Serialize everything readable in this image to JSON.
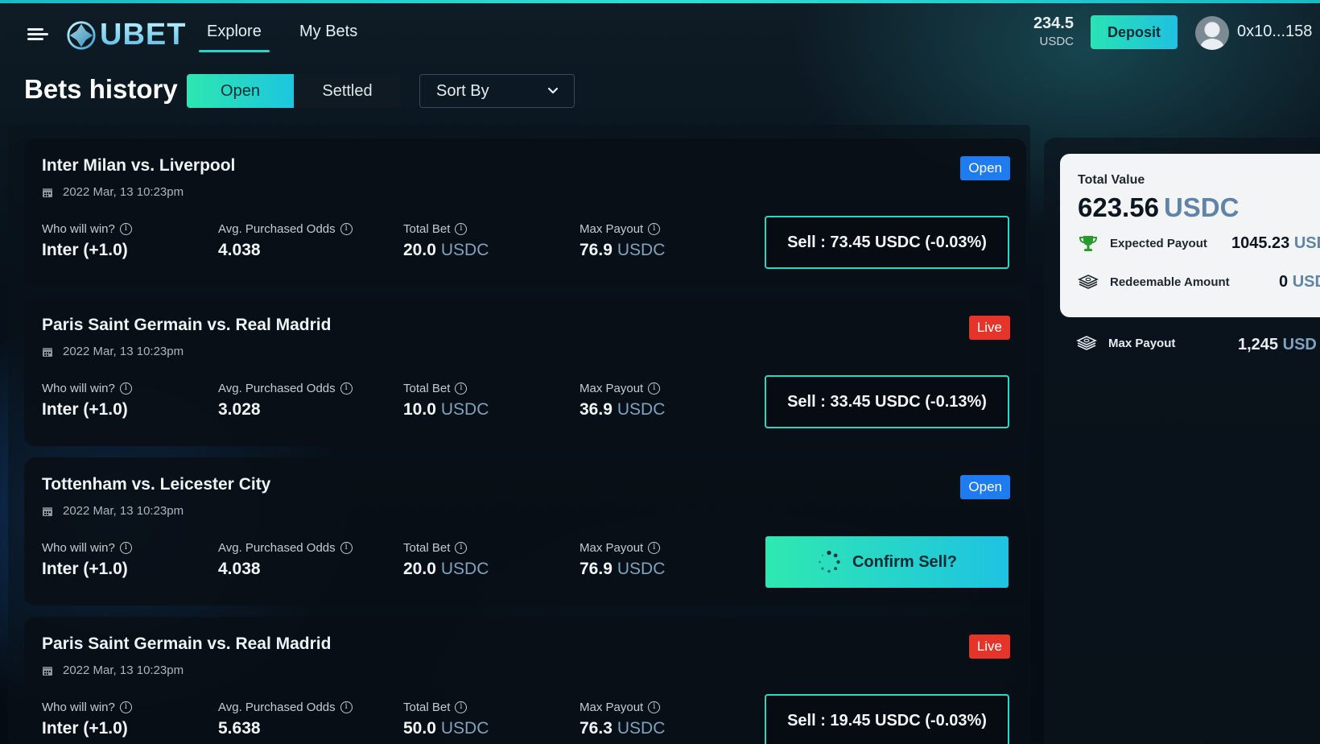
{
  "header": {
    "logo_text": "UBET",
    "nav": [
      {
        "label": "Explore",
        "active": true
      },
      {
        "label": "My Bets",
        "active": false
      }
    ],
    "balance": {
      "amount": "234.5",
      "unit": "USDC"
    },
    "deposit_label": "Deposit",
    "wallet_address": "0x10...158"
  },
  "page": {
    "title": "Bets history",
    "tabs": [
      {
        "label": "Open",
        "active": true
      },
      {
        "label": "Settled",
        "active": false
      }
    ],
    "sort_label": "Sort By"
  },
  "labels": {
    "who_will_win": "Who will win?",
    "avg_odds": "Avg. Purchased Odds",
    "total_bet": "Total Bet",
    "max_payout": "Max Payout",
    "unit": "USDC"
  },
  "bets": [
    {
      "title": "Inter Milan vs. Liverpool",
      "date": "2022 Mar, 13 10:23pm",
      "status": "Open",
      "pick": "Inter (+1.0)",
      "odds": "4.038",
      "total_bet": "20.0",
      "max_payout": "76.9",
      "action": "Sell : 73.45 USDC (-0.03%)"
    },
    {
      "title": "Paris Saint Germain vs. Real Madrid",
      "date": "2022 Mar, 13 10:23pm",
      "status": "Live",
      "pick": "Inter (+1.0)",
      "odds": "3.028",
      "total_bet": "10.0",
      "max_payout": "36.9",
      "action": "Sell : 33.45 USDC (-0.13%)"
    },
    {
      "title": "Tottenham vs. Leicester City",
      "date": "2022 Mar, 13 10:23pm",
      "status": "Open",
      "pick": "Inter (+1.0)",
      "odds": "4.038",
      "total_bet": "20.0",
      "max_payout": "76.9",
      "action": "Confirm Sell?"
    },
    {
      "title": "Paris Saint Germain vs. Real Madrid",
      "date": "2022 Mar, 13 10:23pm",
      "status": "Live",
      "pick": "Inter (+1.0)",
      "odds": "5.638",
      "total_bet": "50.0",
      "max_payout": "76.3",
      "action": "Sell : 19.45 USDC (-0.03%)"
    }
  ],
  "summary": {
    "total_value_label": "Total Value",
    "total_value": "623.56",
    "unit": "USDC",
    "expected_payout_label": "Expected Payout",
    "expected_payout": "1045.23",
    "expected_payout_unit": "USD",
    "redeemable_label": "Redeemable Amount",
    "redeemable": "0",
    "redeemable_unit": "USD",
    "max_payout_label": "Max Payout",
    "max_payout": "1,245",
    "max_payout_unit": "USD"
  },
  "colors": {
    "accent": "#2fd6c4",
    "open_badge": "#1f7cf0",
    "live_badge": "#e5352b"
  }
}
